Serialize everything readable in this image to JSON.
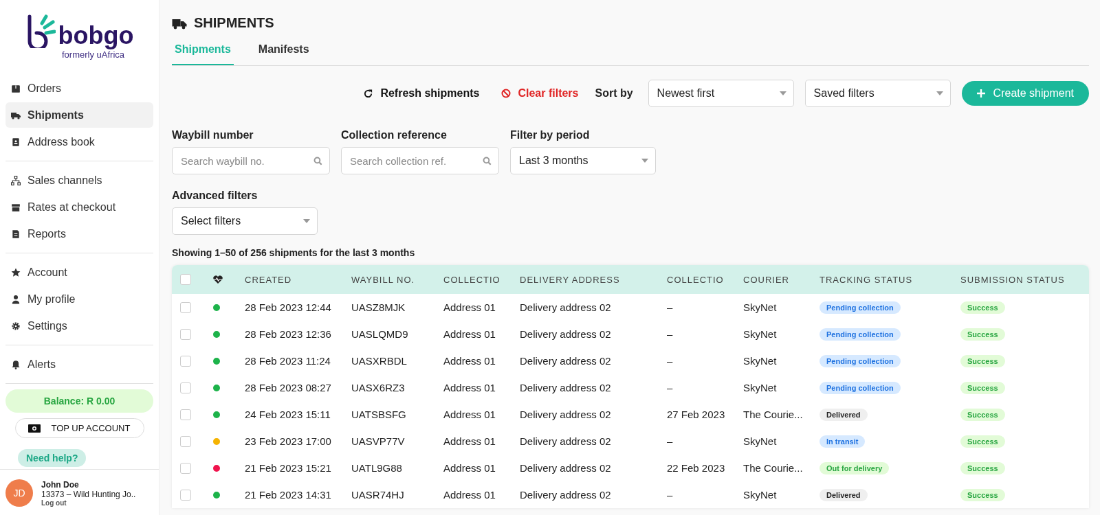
{
  "logo": {
    "name": "bobgo",
    "tagline": "formerly uAfrica"
  },
  "sidebar": {
    "groups": [
      [
        {
          "label": "Orders",
          "kind": "box",
          "selected": false
        },
        {
          "label": "Shipments",
          "kind": "truck",
          "selected": true
        },
        {
          "label": "Address book",
          "kind": "book",
          "selected": false
        }
      ],
      [
        {
          "label": "Sales channels",
          "kind": "network",
          "selected": false
        },
        {
          "label": "Rates at checkout",
          "kind": "store",
          "selected": false
        },
        {
          "label": "Reports",
          "kind": "doc",
          "selected": false
        }
      ],
      [
        {
          "label": "Account",
          "kind": "star",
          "selected": false
        },
        {
          "label": "My profile",
          "kind": "user",
          "selected": false
        },
        {
          "label": "Settings",
          "kind": "gear",
          "selected": false
        }
      ],
      [
        {
          "label": "Alerts",
          "kind": "bell",
          "selected": false
        }
      ]
    ],
    "balance": "Balance: R 0.00",
    "top_up": "TOP UP ACCOUNT",
    "help": "Need help?",
    "user": {
      "initials": "JD",
      "name": "John Doe",
      "account": "13373 – Wild Hunting Jo..",
      "logout": "Log out"
    }
  },
  "page": {
    "title": "SHIPMENTS",
    "tabs": [
      {
        "label": "Shipments",
        "selected": true
      },
      {
        "label": "Manifests",
        "selected": false
      }
    ]
  },
  "toolbar": {
    "refresh": "Refresh shipments",
    "clear": "Clear filters",
    "sort_label": "Sort by",
    "sort_value": "Newest first",
    "saved_filters": "Saved filters",
    "create": "Create shipment"
  },
  "filters": {
    "waybill": {
      "label": "Waybill number",
      "placeholder": "Search waybill no."
    },
    "collection": {
      "label": "Collection reference",
      "placeholder": "Search collection ref."
    },
    "period": {
      "label": "Filter by period",
      "value": "Last 3 months"
    },
    "advanced": {
      "label": "Advanced filters",
      "value": "Select filters"
    }
  },
  "summary": "Showing 1–50 of 256 shipments for the last 3 months",
  "table": {
    "select_all_checked": false,
    "columns": [
      "CREATED",
      "WAYBILL NO.",
      "COLLECTIO",
      "DELIVERY ADDRESS",
      "COLLECTIO",
      "COURIER",
      "TRACKING STATUS",
      "SUBMISSION STATUS"
    ],
    "rows": [
      {
        "checked": false,
        "color": "#1db34a",
        "created": "28 Feb 2023 12:44",
        "waybill": "UASZ8MJK",
        "collection": "Address 01",
        "delivery": "Delivery address 02",
        "collection_date": "–",
        "courier": "SkyNet",
        "tracking": {
          "text": "Pending collection",
          "kind": "info"
        },
        "submission": {
          "text": "Success",
          "kind": "success"
        }
      },
      {
        "checked": false,
        "color": "#1db34a",
        "created": "28 Feb 2023 12:36",
        "waybill": "UASLQMD9",
        "collection": "Address 01",
        "delivery": "Delivery address 02",
        "collection_date": "–",
        "courier": "SkyNet",
        "tracking": {
          "text": "Pending collection",
          "kind": "info"
        },
        "submission": {
          "text": "Success",
          "kind": "success"
        }
      },
      {
        "checked": false,
        "color": "#1db34a",
        "created": "28 Feb 2023 11:24",
        "waybill": "UASXRBDL",
        "collection": "Address 01",
        "delivery": "Delivery address 02",
        "collection_date": "–",
        "courier": "SkyNet",
        "tracking": {
          "text": "Pending collection",
          "kind": "info"
        },
        "submission": {
          "text": "Success",
          "kind": "success"
        }
      },
      {
        "checked": false,
        "color": "#1db34a",
        "created": "28 Feb 2023 08:27",
        "waybill": "UASX6RZ3",
        "collection": "Address 01",
        "delivery": "Delivery address 02",
        "collection_date": "–",
        "courier": "SkyNet",
        "tracking": {
          "text": "Pending collection",
          "kind": "info"
        },
        "submission": {
          "text": "Success",
          "kind": "success"
        }
      },
      {
        "checked": false,
        "color": "#1db34a",
        "created": "24 Feb 2023 15:11",
        "waybill": "UATSBSFG",
        "collection": "Address 01",
        "delivery": "Delivery address 02",
        "collection_date": "27 Feb 2023",
        "courier": "The Courie...",
        "tracking": {
          "text": "Delivered",
          "kind": "neutral"
        },
        "submission": {
          "text": "Success",
          "kind": "success"
        }
      },
      {
        "checked": false,
        "color": "#f5b301",
        "created": "23 Feb 2023 17:00",
        "waybill": "UASVP77V",
        "collection": "Address 01",
        "delivery": "Delivery address 02",
        "collection_date": "–",
        "courier": "SkyNet",
        "tracking": {
          "text": "In transit",
          "kind": "info"
        },
        "submission": {
          "text": "Success",
          "kind": "success"
        }
      },
      {
        "checked": false,
        "color": "#f0134d",
        "created": "21 Feb 2023 15:21",
        "waybill": "UATL9G88",
        "collection": "Address 01",
        "delivery": "Delivery address 02",
        "collection_date": "22 Feb 2023",
        "courier": "The Courie...",
        "tracking": {
          "text": "Out for delivery",
          "kind": "success"
        },
        "submission": {
          "text": "Success",
          "kind": "success"
        }
      },
      {
        "checked": false,
        "color": "#1db34a",
        "created": "21 Feb 2023 14:31",
        "waybill": "UASR74HJ",
        "collection": "Address 01",
        "delivery": "Delivery address 02",
        "collection_date": "–",
        "courier": "SkyNet",
        "tracking": {
          "text": "Delivered",
          "kind": "neutral"
        },
        "submission": {
          "text": "Success",
          "kind": "success"
        }
      }
    ]
  }
}
